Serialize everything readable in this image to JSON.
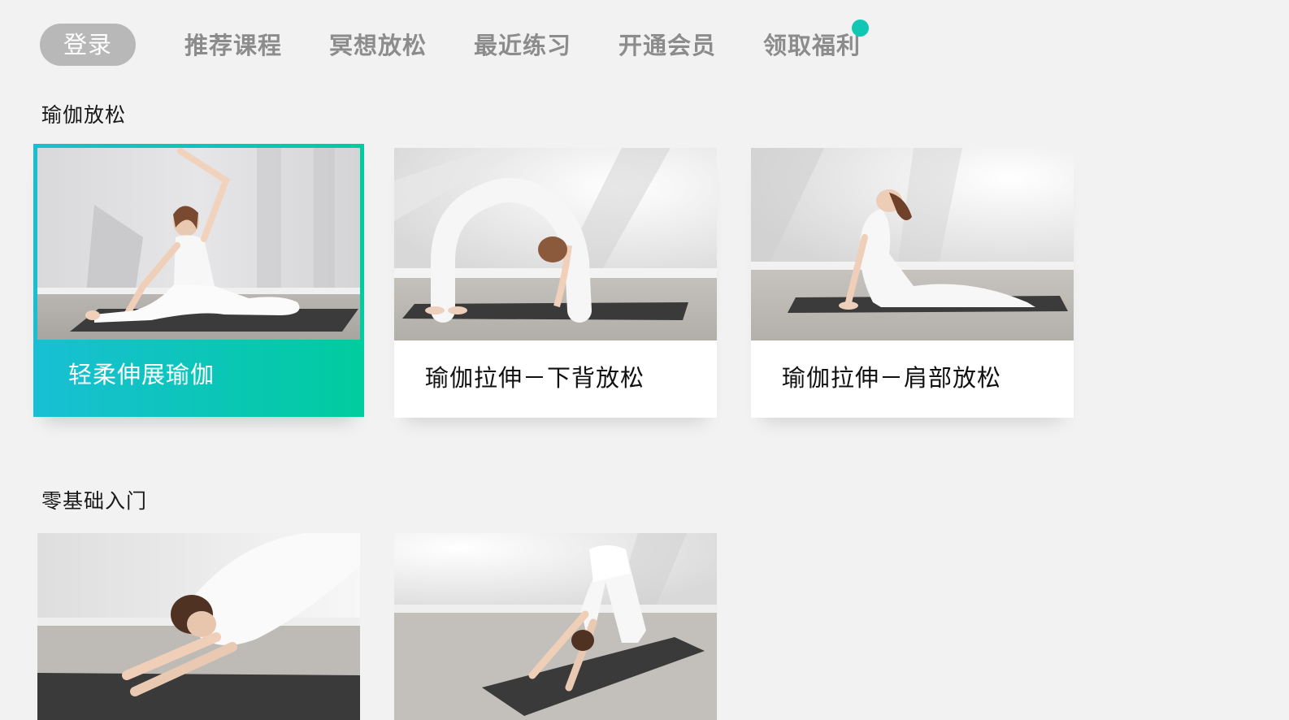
{
  "nav": {
    "login_label": "登录",
    "items": [
      {
        "label": "推荐课程"
      },
      {
        "label": "冥想放松"
      },
      {
        "label": "最近练习"
      },
      {
        "label": "开通会员"
      },
      {
        "label": "领取福利"
      }
    ],
    "badge_color": "#11c7b3"
  },
  "sections": [
    {
      "title": "瑜伽放松",
      "cards": [
        {
          "title": "轻柔伸展瑜伽",
          "focused": true,
          "icon": "side-stretch-yoga-photo"
        },
        {
          "title": "瑜伽拉伸－下背放松",
          "focused": false,
          "icon": "wheel-pose-yoga-photo"
        },
        {
          "title": "瑜伽拉伸－肩部放松",
          "focused": false,
          "icon": "cobra-pose-yoga-photo"
        }
      ]
    },
    {
      "title": "零基础入门",
      "cards": [
        {
          "title": "",
          "icon": "forearm-plank-yoga-photo"
        },
        {
          "title": "",
          "icon": "downward-dog-yoga-photo"
        }
      ]
    }
  ],
  "colors": {
    "accent_start": "#18bfd4",
    "accent_end": "#00cc9f",
    "background": "#f2f2f2",
    "nav_text": "#8c8c8c"
  }
}
